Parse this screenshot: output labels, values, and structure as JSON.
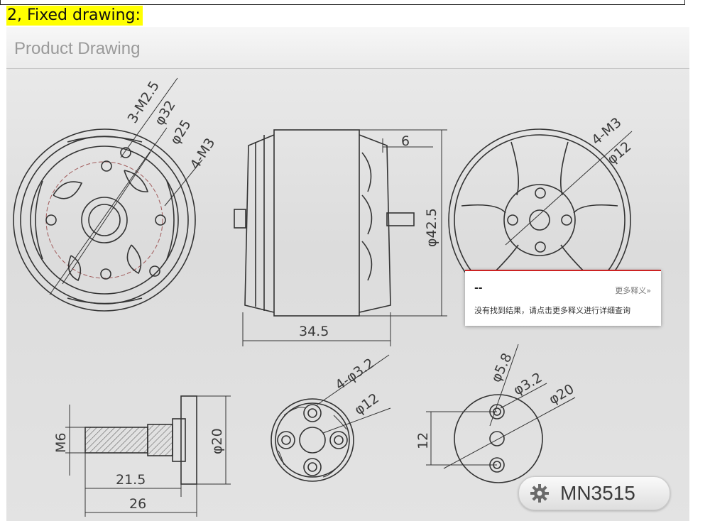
{
  "heading": "2, Fixed drawing:",
  "panel_title": "Product Drawing",
  "dimensions": {
    "mount_screws": "3-M2.5",
    "phi32": "φ32",
    "phi25": "φ25",
    "mount_m3": "4-M3",
    "flange_6": "6",
    "phi42_5": "φ42.5",
    "length_34_5": "34.5",
    "rear_m3": "4-M3",
    "rear_phi12": "φ12",
    "m6": "M6",
    "phi20_shaft": "φ20",
    "len_21_5": "21.5",
    "len_26": "26",
    "holes_phi3_2": "4-φ3.2",
    "hub_phi12": "φ12",
    "phi5_8": "φ5.8",
    "phi3_2": "φ3.2",
    "phi20_plate": "φ20",
    "dim_12": "12"
  },
  "popup": {
    "word": "--",
    "more_link": "更多释义»",
    "message": "没有找到结果，请点击更多释义进行详细查询"
  },
  "badge": {
    "icon": "gear-icon",
    "model": "MN3515"
  }
}
